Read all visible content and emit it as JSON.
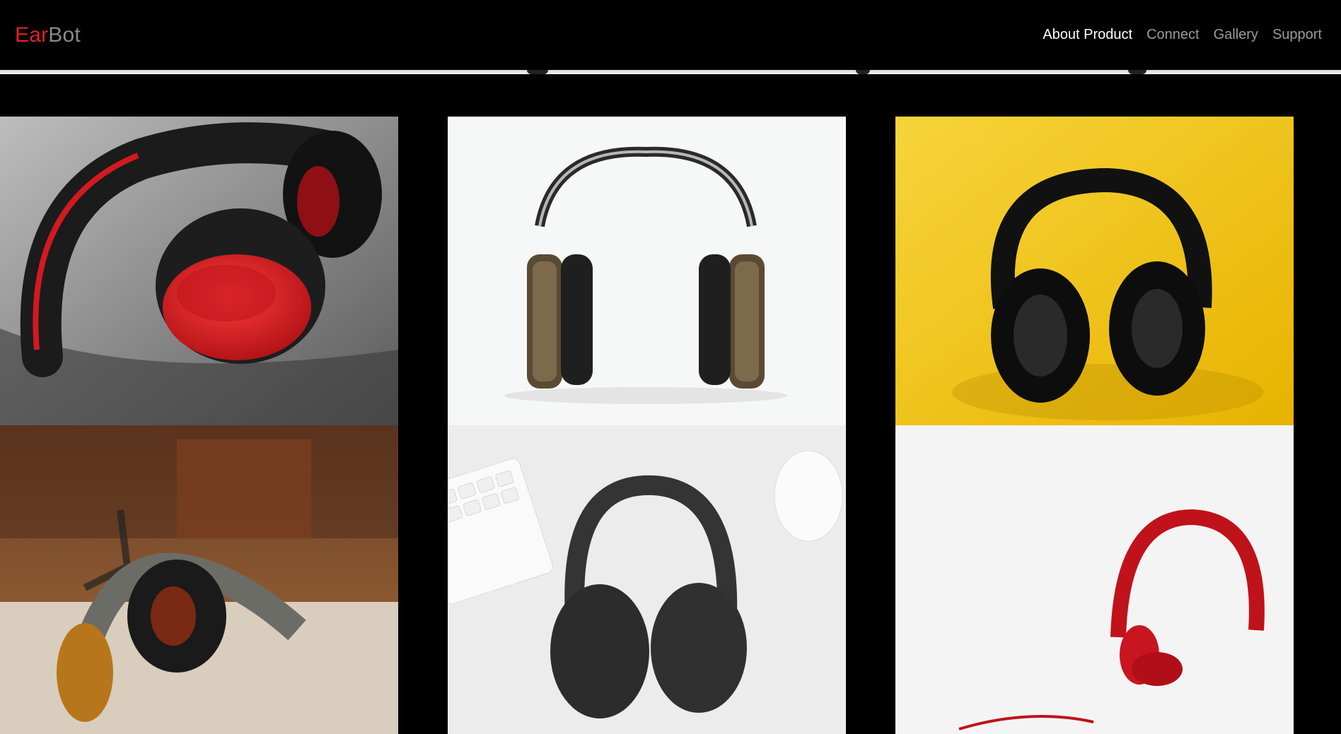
{
  "brand": {
    "part1": "Ear",
    "part2": "Bot"
  },
  "nav": {
    "items": [
      {
        "label": "About Product",
        "active": true
      },
      {
        "label": "Connect",
        "active": false
      },
      {
        "label": "Gallery",
        "active": false
      },
      {
        "label": "Support",
        "active": false
      }
    ]
  },
  "colors": {
    "brand_red": "#e3202a",
    "brand_gray": "#8a8a8a",
    "nav_active": "#ffffff",
    "nav_inactive": "#9a9a9a",
    "background": "#000000"
  },
  "gallery": {
    "images": [
      {
        "name": "red-black-headphones-photo"
      },
      {
        "name": "wooden-studio-headphones-photo"
      },
      {
        "name": "black-headphones-yellow-background-photo"
      },
      {
        "name": "bronze-headphones-on-table-photo"
      },
      {
        "name": "gray-headphones-keyboard-mouse-photo"
      },
      {
        "name": "red-headphones-white-background-photo"
      }
    ]
  }
}
